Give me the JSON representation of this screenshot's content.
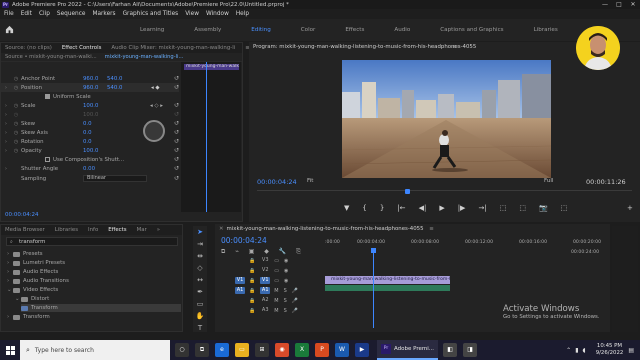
{
  "titlebar": {
    "app_badge": "Pr",
    "title": "Adobe Premiere Pro 2022 - C:\\Users\\Farhan Ali\\Documents\\Adobe\\Premiere Pro\\22.0\\Untitled.prproj *",
    "minimize": "—",
    "maximize": "□",
    "close": "✕"
  },
  "menu": [
    "File",
    "Edit",
    "Clip",
    "Sequence",
    "Markers",
    "Graphics and Titles",
    "View",
    "Window",
    "Help"
  ],
  "workspaces": {
    "items": [
      "Learning",
      "Assembly",
      "Editing",
      "Color",
      "Effects",
      "Audio",
      "Captions and Graphics",
      "Libraries"
    ],
    "active": "Editing",
    "more": "»"
  },
  "source_panel": {
    "tabs": [
      "Source: (no clips)",
      "Effect Controls",
      "Audio Clip Mixer: mixkit-young-man-walking-li"
    ],
    "active_tab": "Effect Controls",
    "menu_icon": "≡",
    "header_label": "Source • mixkit-young-man-walki...",
    "header_clip": "mixkit-young-man-walking-li...",
    "mini_clip": "mixkit-young-man-walking-li",
    "properties": [
      {
        "name": "Anchor Point",
        "v1": "960.0",
        "v2": "540.0"
      },
      {
        "name": "Position",
        "v1": "960.0",
        "v2": "540.0"
      },
      {
        "name": "Uniform Scale",
        "type": "checkbox",
        "checked": true
      },
      {
        "name": "Scale",
        "v1": "100.0"
      },
      {
        "name": "",
        "v1": "100.0",
        "dim": true
      },
      {
        "name": "Skew",
        "v1": "0.0"
      },
      {
        "name": "Skew Axis",
        "v1": "0.0"
      },
      {
        "name": "Rotation",
        "v1": "0.0"
      },
      {
        "name": "Opacity",
        "v1": "100.0"
      },
      {
        "name": "Use Composition's Shutt...",
        "type": "checkbox",
        "checked": false
      },
      {
        "name": "Shutter Angle",
        "v1": "0.00"
      },
      {
        "name": "Sampling",
        "type": "dropdown",
        "value": "Bilinear"
      }
    ],
    "timecode": "00:00:04:24"
  },
  "program": {
    "title": "Program: mixkit-young-man-walking-listening-to-music-from-his-headphones-4055",
    "menu_icon": "≡",
    "timecode_left": "00:00:04:24",
    "fit": "Fit",
    "quality": "Full",
    "timecode_right": "00:00:11:26",
    "transport": [
      "▼",
      "{",
      "}",
      "|←",
      "◀|",
      "▶",
      "|▶",
      "→|",
      "⬚",
      "⬚",
      "📷",
      "⬚"
    ],
    "add": "+"
  },
  "project_panel": {
    "tabs": [
      "Media Browser",
      "Libraries",
      "Info",
      "Effects",
      "Mar"
    ],
    "active_tab": "Effects",
    "more": "»",
    "search_value": "transform",
    "tree": [
      {
        "label": "Presets",
        "level": 0
      },
      {
        "label": "Lumetri Presets",
        "level": 0
      },
      {
        "label": "Audio Effects",
        "level": 0
      },
      {
        "label": "Audio Transitions",
        "level": 0
      },
      {
        "label": "Video Effects",
        "level": 0,
        "open": true
      },
      {
        "label": "Distort",
        "level": 1,
        "open": true
      },
      {
        "label": "Transform",
        "level": 2,
        "selected": true
      },
      {
        "label": "Transform",
        "level": 0
      }
    ]
  },
  "timeline": {
    "tab": "mixkit-young-man-walking-listening-to-music-from-his-headphones-4055",
    "menu_icon": "≡",
    "timecode": "00:00:04:24",
    "ruler": [
      ":00:00",
      "00:00:04:00",
      "00:00:08:00",
      "00:00:12:00",
      "00:00:16:00",
      "00:00:20:00",
      "00:00:24:00"
    ],
    "tracks": [
      "V3",
      "V2",
      "V1",
      "A1",
      "A2",
      "A3"
    ],
    "active_tracks": [
      "V1",
      "A1"
    ],
    "clip_label": "mixkit-young-man-walking-listening-to-music-from-his-he"
  },
  "watermark": {
    "line1": "Activate Windows",
    "line2": "Go to Settings to activate Windows."
  },
  "taskbar": {
    "search_placeholder": "Type here to search",
    "app_badge": "Pr",
    "app_label": "Adobe Premi...",
    "time": "10:45 PM",
    "date": "9/26/2022"
  },
  "colors": {
    "accent": "#3d86ff",
    "brand": "#2a1a6a",
    "clip": "#a79cd8"
  }
}
